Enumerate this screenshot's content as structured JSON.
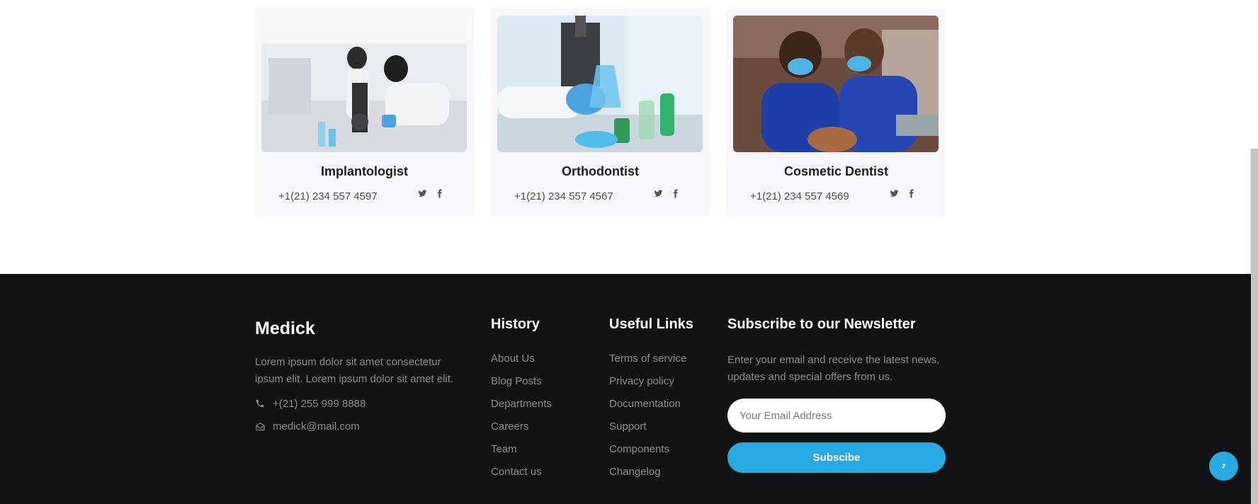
{
  "team": [
    {
      "name": "Implantologist",
      "phone": "+1(21) 234 557 4597",
      "image": "lab-microscope-photo",
      "icons": [
        "twitter-icon",
        "facebook-icon"
      ]
    },
    {
      "name": "Orthodontist",
      "phone": "+1(21) 234 557 4567",
      "image": "lab-flask-photo",
      "icons": [
        "twitter-icon",
        "facebook-icon"
      ]
    },
    {
      "name": "Cosmetic Dentist",
      "phone": "+1(21) 234 557 4569",
      "image": "dentists-photo",
      "icons": [
        "twitter-icon",
        "facebook-icon"
      ]
    }
  ],
  "footer": {
    "brand": "Medick",
    "about": "Lorem ipsum dolor sit amet consectetur ipsum elit. Lorem ipsum dolor sit amet elit.",
    "phone": "+(21) 255 999 8888",
    "email": "medick@mail.com",
    "history": {
      "title": "History",
      "links": [
        "About Us",
        "Blog Posts",
        "Departments",
        "Careers",
        "Team",
        "Contact us"
      ]
    },
    "useful": {
      "title": "Useful Links",
      "links": [
        "Terms of service",
        "Privacy policy",
        "Documentation",
        "Support",
        "Components",
        "Changelog"
      ]
    },
    "newsletter": {
      "title": "Subscribe to our Newsletter",
      "text": "Enter your email and receive the latest news, updates and special offers from us.",
      "placeholder": "Your Email Address",
      "button": "Subscibe"
    }
  },
  "colors": {
    "accent": "#27a9e1",
    "footer_bg": "#111214",
    "card_bg": "#f7f7fb"
  }
}
